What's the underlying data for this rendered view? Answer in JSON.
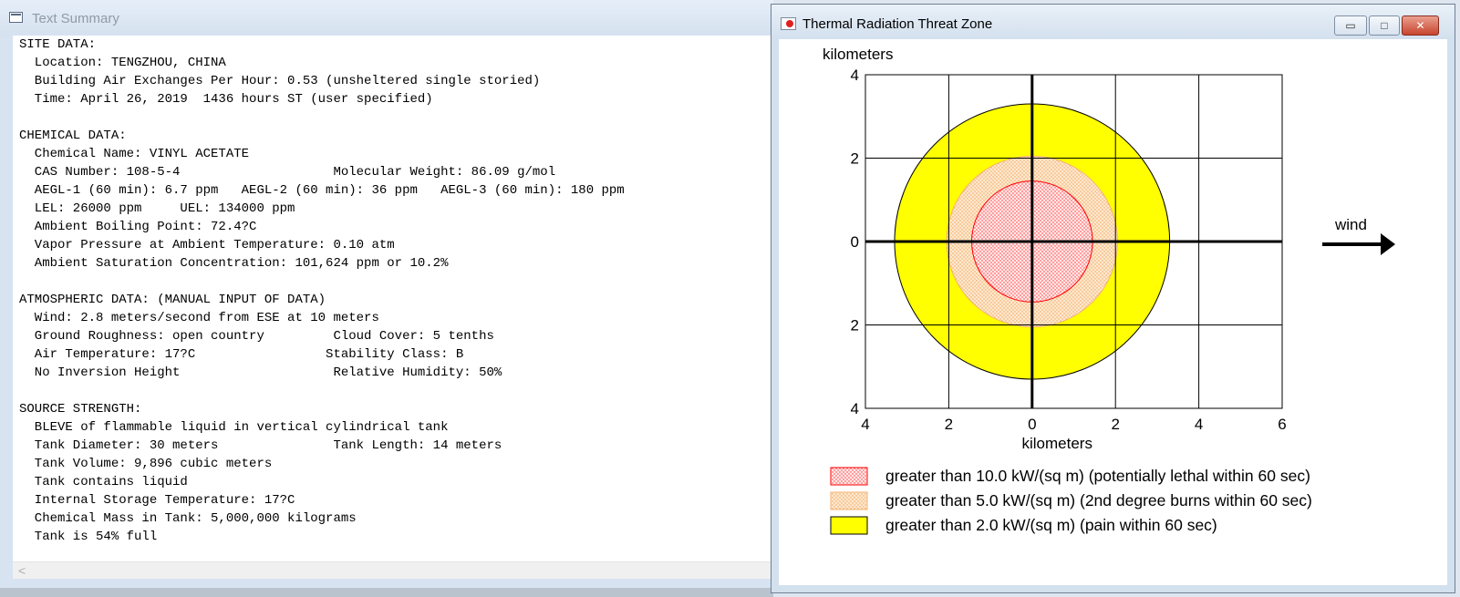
{
  "left_window": {
    "title": "Text Summary",
    "lines": [
      "SITE DATA:",
      "  Location: TENGZHOU, CHINA",
      "  Building Air Exchanges Per Hour: 0.53 (unsheltered single storied)",
      "  Time: April 26, 2019  1436 hours ST (user specified)",
      "",
      "CHEMICAL DATA:",
      "  Chemical Name: VINYL ACETATE",
      "  CAS Number: 108-5-4                    Molecular Weight: 86.09 g/mol",
      "  AEGL-1 (60 min): 6.7 ppm   AEGL-2 (60 min): 36 ppm   AEGL-3 (60 min): 180 ppm",
      "  LEL: 26000 ppm     UEL: 134000 ppm",
      "  Ambient Boiling Point: 72.4?C",
      "  Vapor Pressure at Ambient Temperature: 0.10 atm",
      "  Ambient Saturation Concentration: 101,624 ppm or 10.2%",
      "",
      "ATMOSPHERIC DATA: (MANUAL INPUT OF DATA)",
      "  Wind: 2.8 meters/second from ESE at 10 meters",
      "  Ground Roughness: open country         Cloud Cover: 5 tenths",
      "  Air Temperature: 17?C                 Stability Class: B",
      "  No Inversion Height                    Relative Humidity: 50%",
      "",
      "SOURCE STRENGTH:",
      "  BLEVE of flammable liquid in vertical cylindrical tank",
      "  Tank Diameter: 30 meters               Tank Length: 14 meters",
      "  Tank Volume: 9,896 cubic meters",
      "  Tank contains liquid",
      "  Internal Storage Temperature: 17?C",
      "  Chemical Mass in Tank: 5,000,000 kilograms",
      "  Tank is 54% full"
    ],
    "scroll_left_glyph": "<"
  },
  "right_window": {
    "title": "Thermal Radiation Threat Zone",
    "buttons": {
      "minimize": "▭",
      "maximize": "□",
      "close": "✕"
    }
  },
  "chart_data": {
    "type": "area",
    "xlabel": "kilometers",
    "ylabel": "kilometers",
    "xlim": [
      -4,
      6
    ],
    "ylim": [
      -4,
      4
    ],
    "x_ticks": [
      "4",
      "2",
      "0",
      "2",
      "4",
      "6"
    ],
    "y_ticks": [
      "4",
      "2",
      "0",
      "2",
      "4"
    ],
    "grid": true,
    "wind_label": "wind",
    "wind_direction": "east",
    "zones": [
      {
        "threshold_label": "greater than 10.0 kW/(sq m) (potentially lethal within 60 sec)",
        "radius_km": 1.45,
        "fill": "#ffe7e7",
        "stroke": "#ff0000",
        "pattern": "red-dots"
      },
      {
        "threshold_label": "greater than 5.0 kW/(sq m) (2nd degree burns within 60 sec)",
        "radius_km": 2.05,
        "fill": "#fde3c8",
        "stroke": "#f5b070",
        "pattern": "orange-dots"
      },
      {
        "threshold_label": "greater than 2.0 kW/(sq m) (pain within 60 sec)",
        "radius_km": 3.3,
        "fill": "#ffff00",
        "stroke": "#000000",
        "pattern": "solid"
      }
    ]
  }
}
